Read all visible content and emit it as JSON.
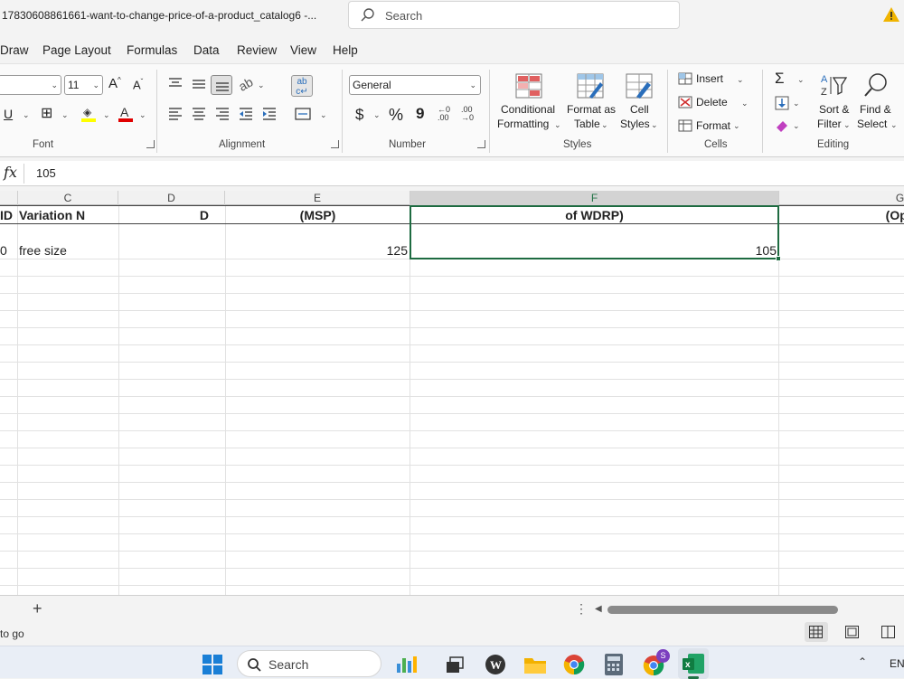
{
  "window": {
    "title": "17830608861661-want-to-change-price-of-a-product_catalog6  -...",
    "search_placeholder": "Search"
  },
  "menu": [
    "Draw",
    "Page Layout",
    "Formulas",
    "Data",
    "Review",
    "View",
    "Help"
  ],
  "ribbon": {
    "font_size": "11",
    "number_format": "General",
    "styles": {
      "conditional_1": "Conditional",
      "conditional_2": "Formatting",
      "format_table_1": "Format as",
      "format_table_2": "Table",
      "cell_styles_1": "Cell",
      "cell_styles_2": "Styles"
    },
    "cells": {
      "insert": "Insert",
      "delete": "Delete",
      "format": "Format"
    },
    "editing": {
      "sort_1": "Sort &",
      "sort_2": "Filter",
      "find_1": "Find &",
      "find_2": "Select"
    },
    "groups": {
      "font": "Font",
      "alignment": "Alignment",
      "number": "Number",
      "styles": "Styles",
      "cells": "Cells",
      "editing": "Editing"
    },
    "number_symbols": {
      "currency": "$",
      "percent": "%",
      "comma": "9"
    }
  },
  "formula_bar": {
    "fx": "fx",
    "value": "105"
  },
  "grid": {
    "columns": [
      "C",
      "D",
      "E",
      "F",
      "G"
    ],
    "header_row": {
      "b": "ID",
      "c": "Variation N",
      "d": "D",
      "e": "(MSP)",
      "f": "of WDRP)",
      "g": "(Opti"
    },
    "data_row": {
      "b": "0",
      "c": "free size",
      "e": "125",
      "f": "105"
    }
  },
  "sheet_tabs": {
    "add": "+"
  },
  "status": {
    "text": "to go"
  },
  "taskbar": {
    "search": "Search",
    "language": "ENG",
    "chrome_badge": "S"
  },
  "colors": {
    "excel_green": "#217346",
    "selection_border": "#1e6b41"
  }
}
